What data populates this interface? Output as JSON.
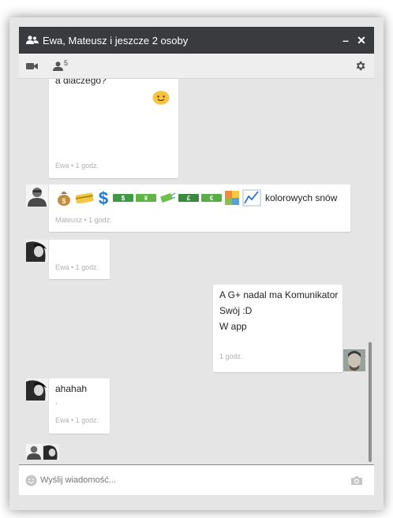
{
  "header": {
    "title": "Ewa, Mateusz i jeszcze 2 osoby",
    "minimize_label": "–",
    "close_label": "✕"
  },
  "toolbar": {
    "participant_count": "5"
  },
  "messages": {
    "m1": {
      "partial_text": "a dlaczego?",
      "meta": "Ewa • 1 godz."
    },
    "m2": {
      "text": "kolorowych snów",
      "meta": "Mateusz • 1 godz.",
      "note_labels": [
        "$",
        "¥",
        "£",
        "€"
      ]
    },
    "m3": {
      "meta": "Ewa • 1 godz."
    },
    "m4": {
      "line1": "A G+ nadal ma Komunikator",
      "line2": "Swój :D",
      "line3": "W app",
      "meta": "1 godz."
    },
    "m5": {
      "text": "ahahah",
      "second_line": ",",
      "meta": "Ewa • 1 godz."
    }
  },
  "composer": {
    "placeholder": "Wyślij wiadomość..."
  },
  "colors": {
    "titlebar": "#393b3e",
    "background": "#e5e5e5",
    "accent": "#5b8fd9",
    "emoji_yellow": "#f6c342",
    "note_green": "#4caf50"
  }
}
